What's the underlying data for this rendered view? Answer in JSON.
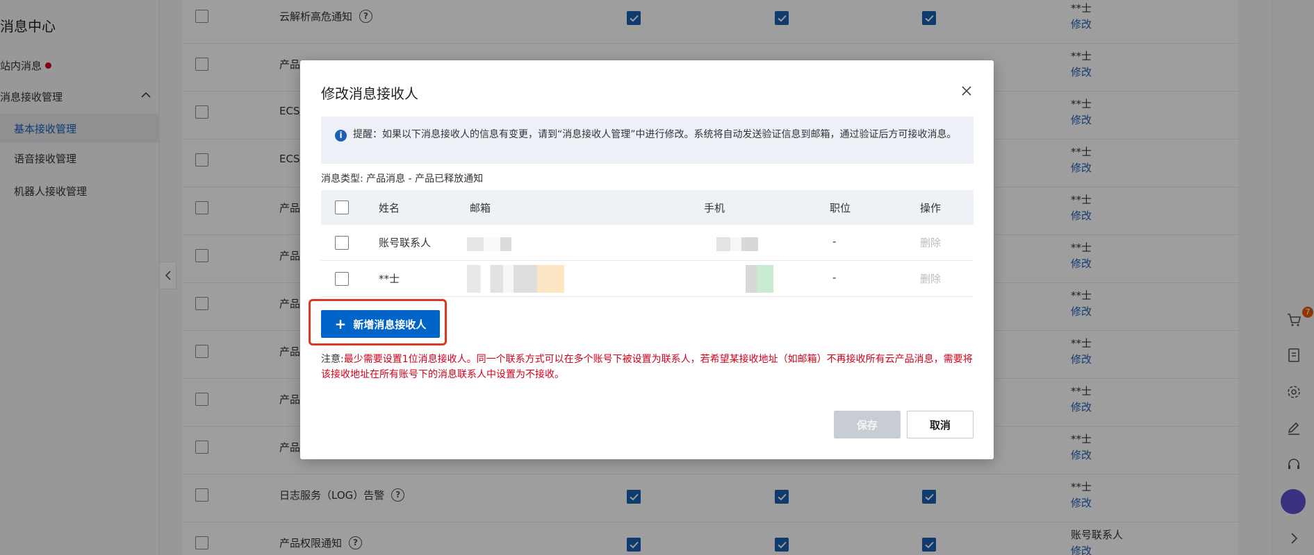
{
  "sidebar": {
    "title": "消息中心",
    "items": [
      {
        "label": "站内消息"
      },
      {
        "label": "消息接收管理"
      }
    ],
    "subitems": [
      {
        "label": "基本接收管理"
      },
      {
        "label": "语音接收管理"
      },
      {
        "label": "机器人接收管理"
      }
    ]
  },
  "table": {
    "rows": [
      {
        "name": "云解析高危通知",
        "recv": "**士",
        "edit": "修改"
      },
      {
        "name": "产品",
        "recv": "**士",
        "edit": "修改"
      },
      {
        "name": "ECS/",
        "recv": "**士",
        "edit": "修改"
      },
      {
        "name": "ECS/",
        "recv": "**士",
        "edit": "修改"
      },
      {
        "name": "产品",
        "recv": "**士",
        "edit": "修改"
      },
      {
        "name": "产品",
        "recv": "**士",
        "edit": "修改"
      },
      {
        "name": "产品",
        "recv": "**士",
        "edit": "修改"
      },
      {
        "name": "产品",
        "recv": "**士",
        "edit": "修改"
      },
      {
        "name": "产品",
        "recv": "**士",
        "edit": "修改"
      },
      {
        "name": "产品",
        "recv": "**士",
        "edit": "修改"
      },
      {
        "name": "日志服务（LOG）告警",
        "recv": "**士",
        "edit": "修改"
      },
      {
        "name": "产品权限通知",
        "recv": "账号联系人",
        "edit": "修改"
      }
    ]
  },
  "rail": {
    "cart_badge": "7"
  },
  "modal": {
    "title": "修改消息接收人",
    "tip": "提醒：如果以下消息接收人的信息有变更，请到“消息接收人管理”中进行修改。系统将自动发送验证信息到邮箱，通过验证后方可接收消息。",
    "message_type": "消息类型: 产品消息 - 产品已释放通知",
    "columns": {
      "name": "姓名",
      "email": "邮箱",
      "phone": "手机",
      "position": "职位",
      "action": "操作"
    },
    "rows": [
      {
        "name": "账号联系人",
        "position": "-",
        "action": "删除"
      },
      {
        "name": "**士",
        "position": "-",
        "action": "删除"
      }
    ],
    "add_label": "新增消息接收人",
    "note_label": "注意:",
    "note_text": "最少需要设置1位消息接收人。同一个联系方式可以在多个账号下被设置为联系人，若希望某接收地址（如邮箱）不再接收所有云产品消息，需要将该接收地址在所有账号下的消息联系人中设置为不接收。",
    "save_label": "保存",
    "cancel_label": "取消"
  },
  "colors": {
    "primary": "#0064c8",
    "highlight": "#d9391e",
    "warning_text": "#d0021b",
    "check": "#1a5fb4"
  }
}
